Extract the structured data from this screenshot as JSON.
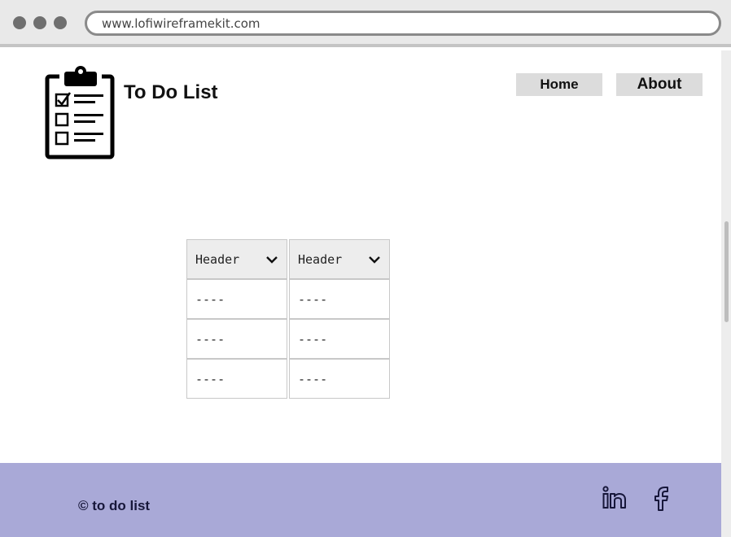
{
  "browser": {
    "url": "www.lofiwireframekit.com"
  },
  "header": {
    "title": "To Do List",
    "logo_icon": "clipboard-checklist-icon",
    "nav": [
      {
        "label": "Home"
      },
      {
        "label": "About"
      }
    ]
  },
  "table": {
    "headers": [
      "Header",
      "Header"
    ],
    "rows": [
      [
        "----",
        "----"
      ],
      [
        "----",
        "----"
      ],
      [
        "----",
        "----"
      ]
    ]
  },
  "footer": {
    "copyright": "© to do list",
    "social": [
      "linkedin-icon",
      "facebook-icon"
    ],
    "background": "#a9a9d7"
  }
}
